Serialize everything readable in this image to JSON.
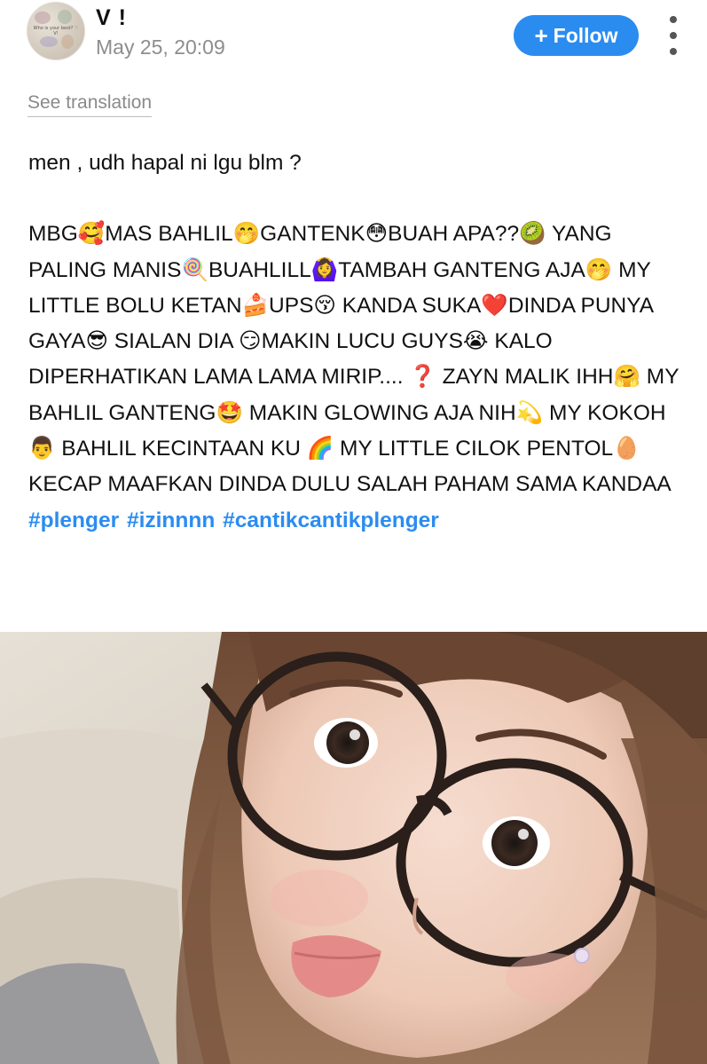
{
  "header": {
    "avatar_text": "Who is your best? ♡ V!",
    "username": "V !",
    "timestamp": "May 25, 20:09",
    "follow_plus": "+",
    "follow_label": "Follow"
  },
  "post": {
    "see_translation": "See translation",
    "intro": "men , udh hapal ni lgu blm ?",
    "main_text": "MBG🥰MAS BAHLIL🤭GANTENK😳BUAH APA??🥝 YANG PALING MANIS🍭BUAHLILL🙆‍♀️TAMBAH GANTENG AJA🤭 MY LITTLE BOLU KETAN🍰UPS😚 KANDA SUKA❤️DINDA PUNYA GAYA😎 SIALAN DIA 😏MAKIN LUCU GUYS😭 KALO DIPERHATIKAN LAMA LAMA MIRIP.... ❓ ZAYN MALIK IHH🤗 MY BAHLIL GANTENG🤩 MAKIN GLOWING AJA NIH💫 MY KOKOH 👨 BAHLIL KECINTAAN KU 🌈 MY LITTLE CILOK PENTOL🥚 KECAP MAAFKAN DINDA DULU SALAH PAHAM SAMA KANDAA",
    "hashtags": [
      "#plenger",
      "#izinnnn",
      "#cantikcantikplenger"
    ]
  },
  "colors": {
    "accent": "#2b8cf0",
    "timestamp": "#8d8d8d",
    "text": "#111111"
  },
  "icons": {
    "more": "vertical-ellipsis-icon",
    "follow": "plus-icon"
  }
}
